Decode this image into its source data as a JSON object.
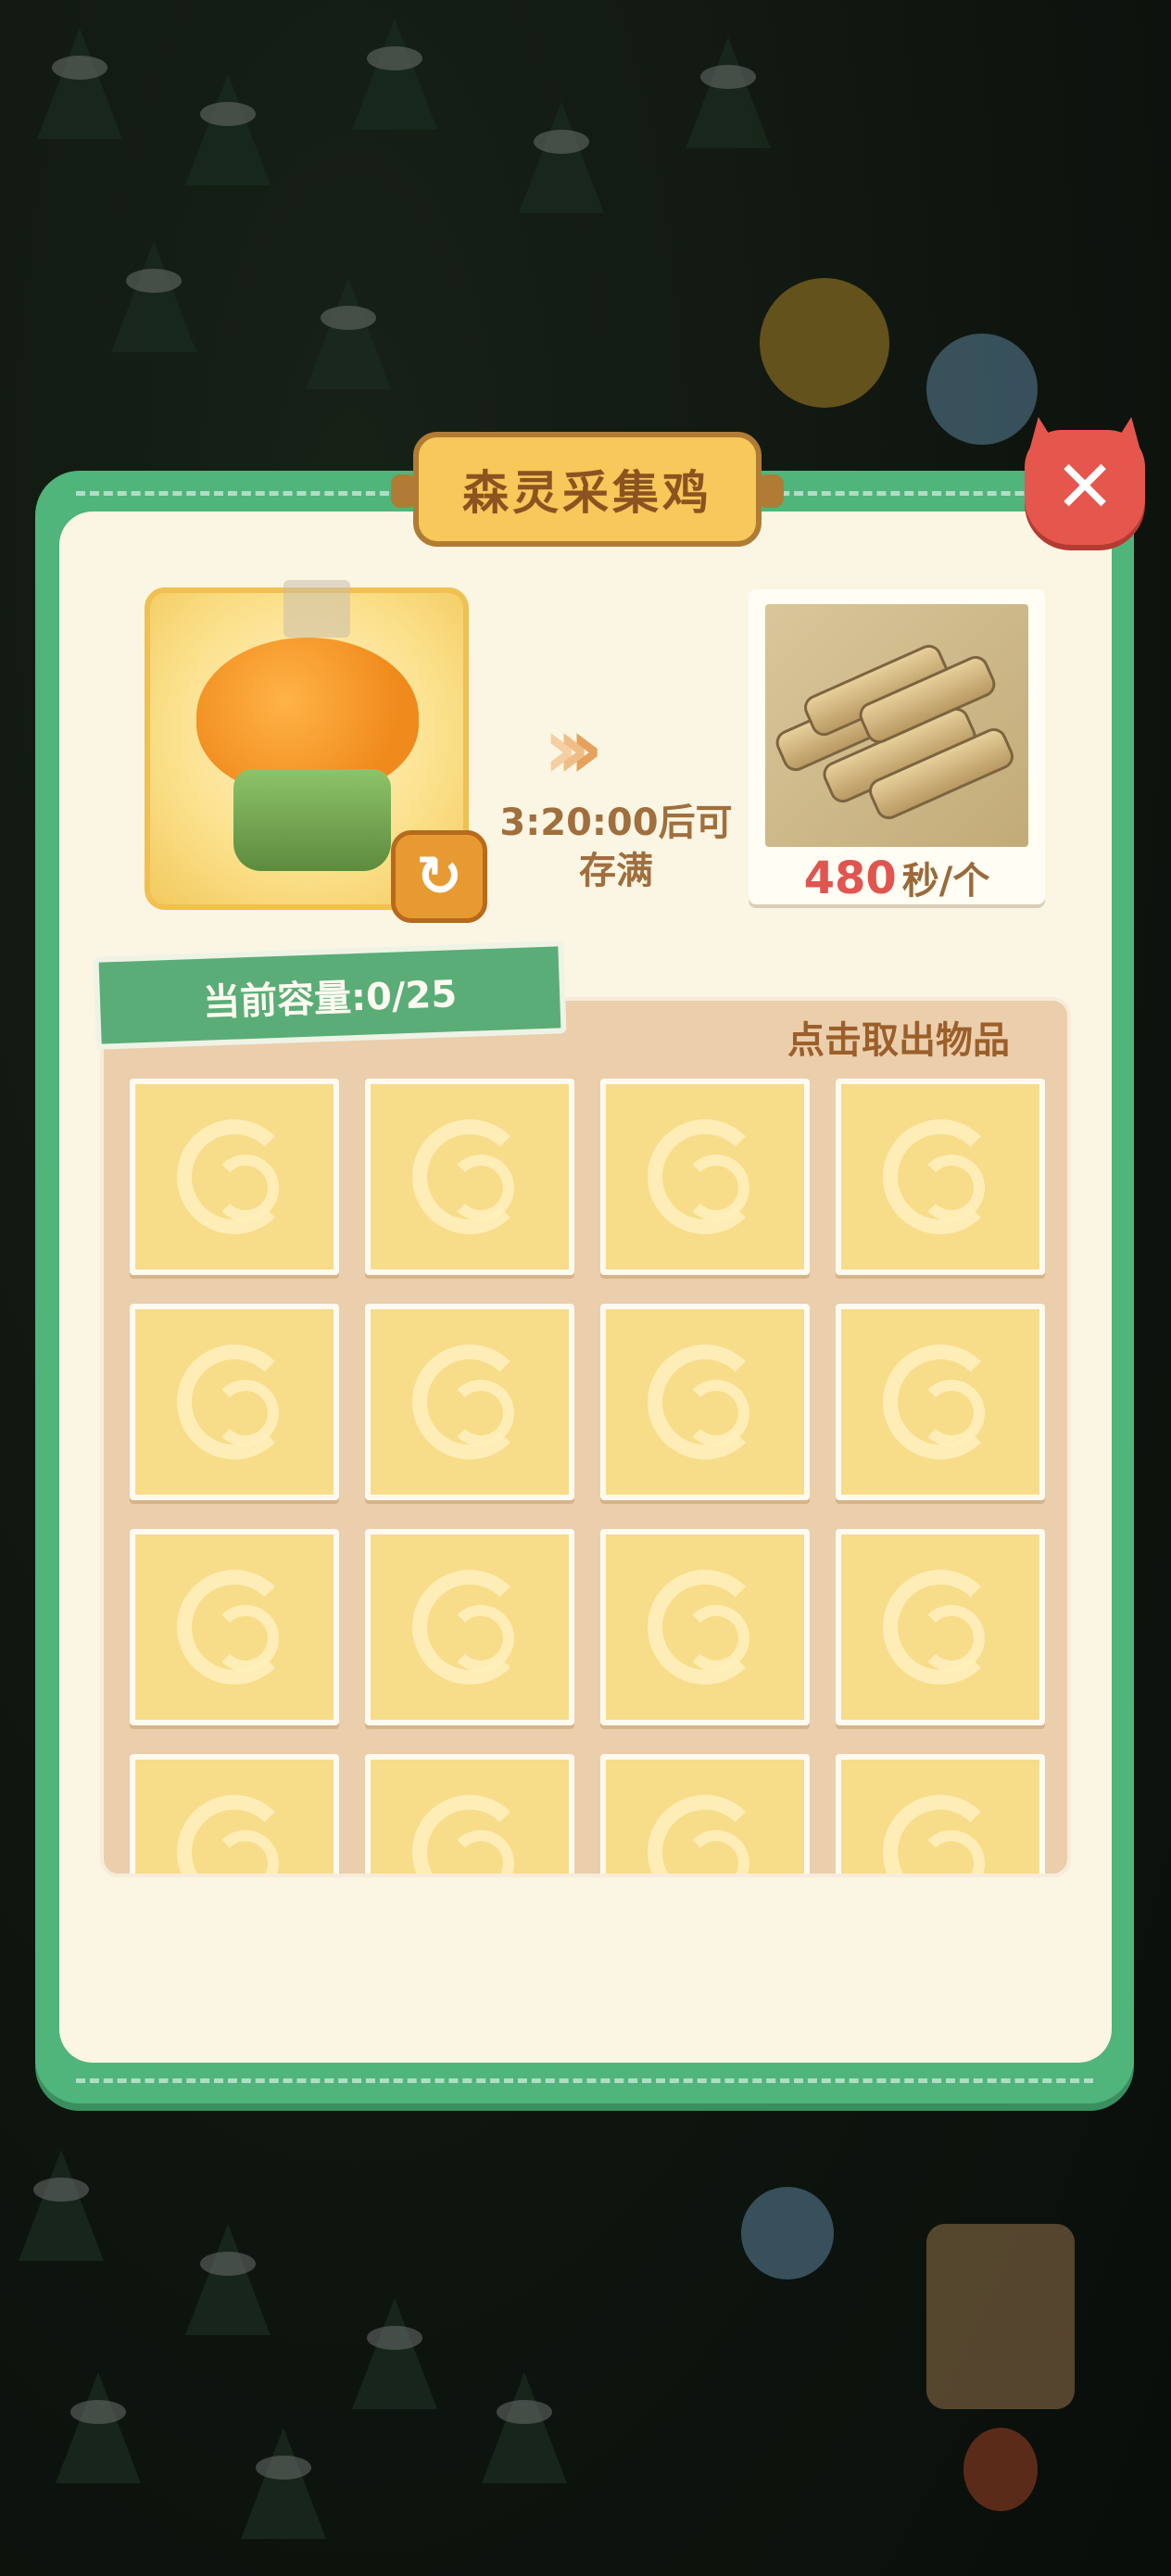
{
  "dialog": {
    "title": "森灵采集鸡",
    "close_label": "✕"
  },
  "production": {
    "refresh_icon": "refresh-icon",
    "fill_time": "3:20:00后可存满",
    "resource_name": "wood-logs",
    "rate_value": "480",
    "rate_unit": "秒/个"
  },
  "storage": {
    "capacity_label": "当前容量:0/25",
    "take_out_hint": "点击取出物品",
    "slots_visible": 16
  },
  "colors": {
    "panel_green": "#4fb57a",
    "panel_cream": "#fbf5e3",
    "title_gold": "#f7c85a",
    "close_red": "#e5564c",
    "rate_red": "#e05550"
  }
}
